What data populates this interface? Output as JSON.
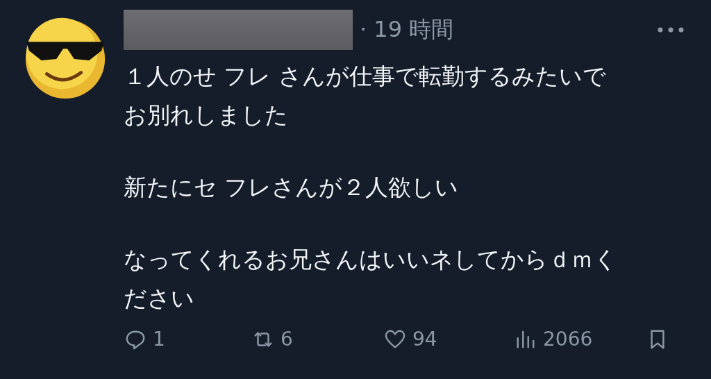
{
  "post": {
    "time": "· 19 時間",
    "paragraphs": [
      [
        "１人のせ フレ さんが仕事で転勤するみたいで",
        "お別れしました"
      ],
      [
        "新たにセ フレさんが２人欲しい"
      ],
      [
        "なってくれるお兄さんはいいネしてからｄｍく",
        "ださい"
      ]
    ],
    "actions": [
      {
        "kind": "reply",
        "count": "1"
      },
      {
        "kind": "repost",
        "count": "6"
      },
      {
        "kind": "like",
        "count": "94"
      },
      {
        "kind": "views",
        "count": "2066"
      },
      {
        "kind": "bookmark"
      }
    ]
  }
}
